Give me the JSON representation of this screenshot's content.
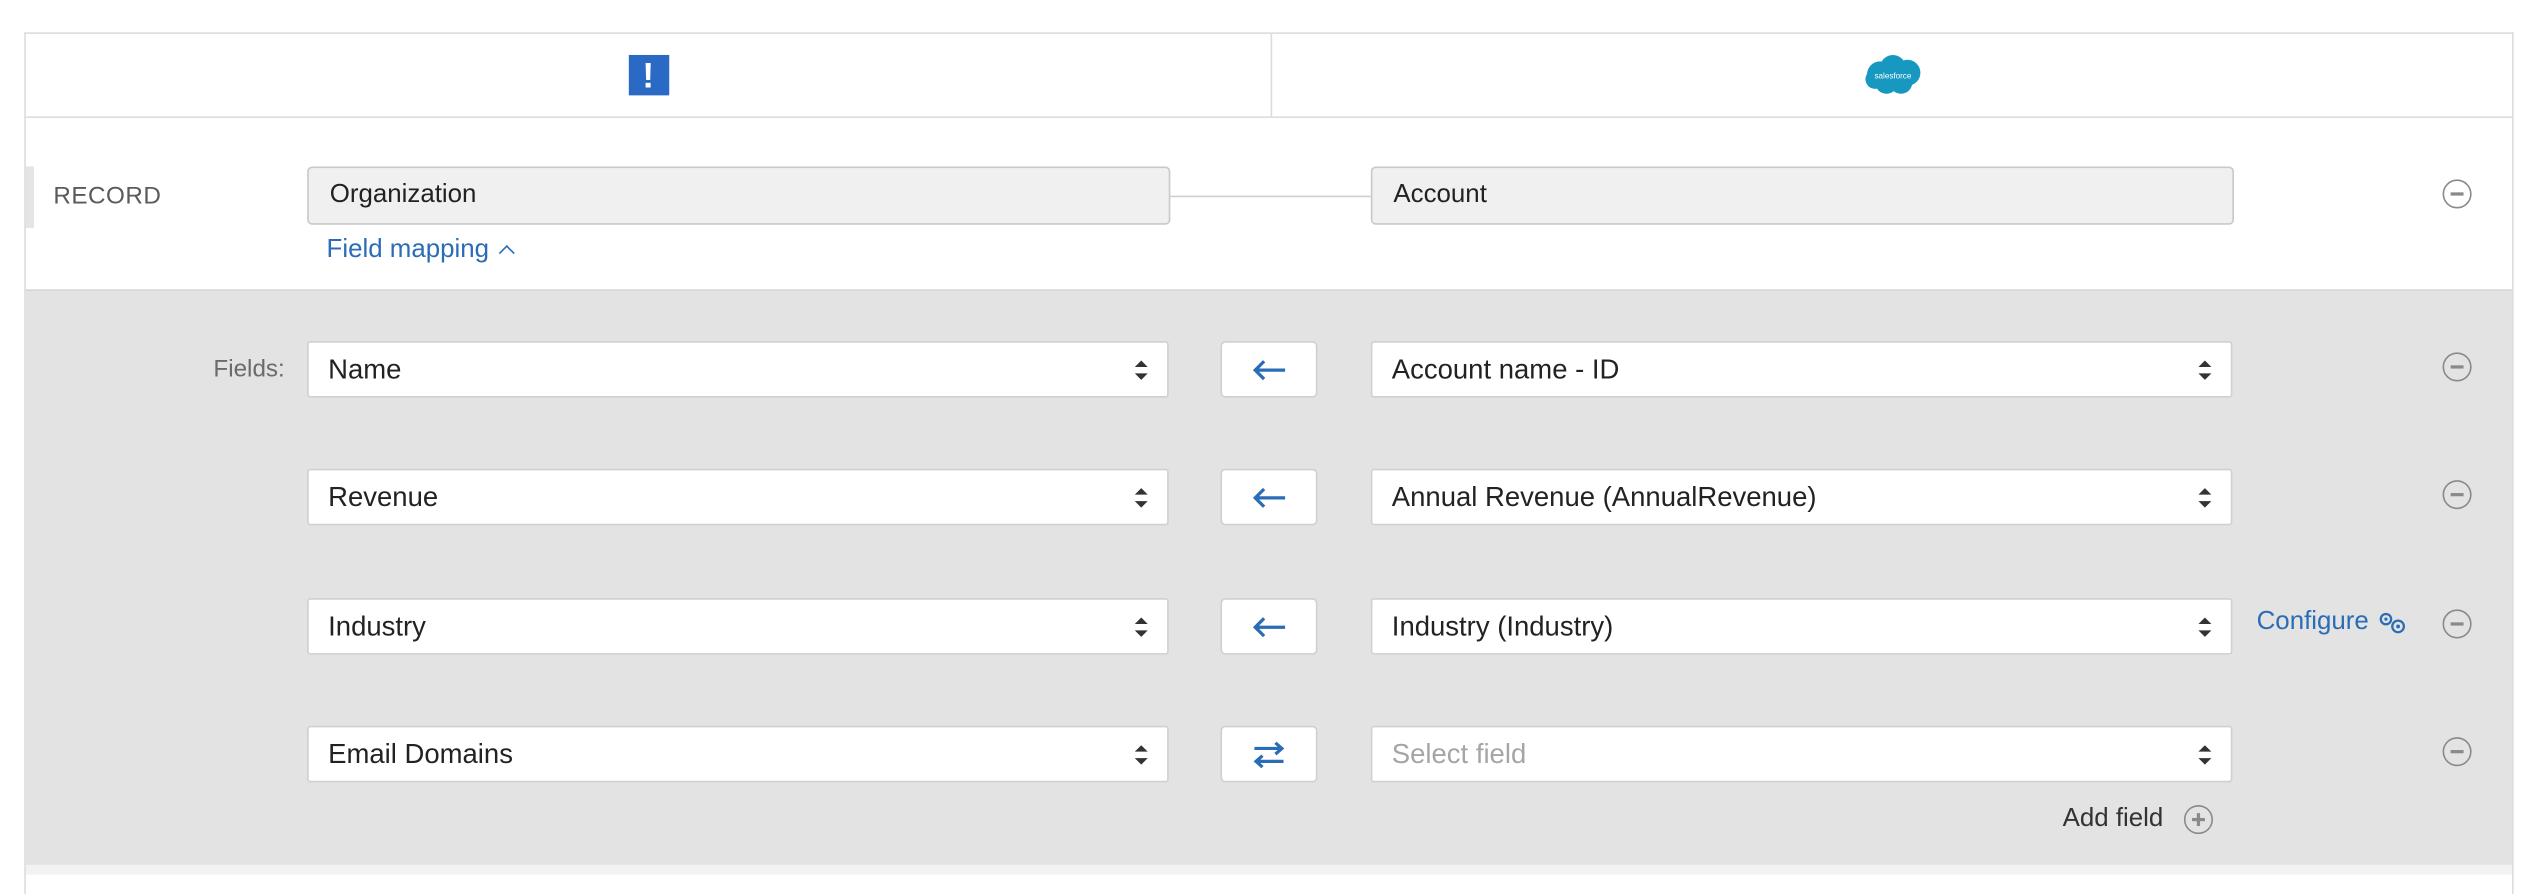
{
  "header": {
    "left_app_icon": "exclamation-app-icon",
    "right_app_icon": "salesforce-cloud-icon",
    "right_app_logo_text": "salesforce"
  },
  "record": {
    "label": "RECORD",
    "source_object": "Organization",
    "target_object": "Account",
    "field_mapping_link": "Field mapping"
  },
  "fields": {
    "label": "Fields:",
    "rows": [
      {
        "source": "Name",
        "direction": "arrow-left-icon",
        "target": "Account name - ID"
      },
      {
        "source": "Revenue",
        "direction": "arrow-left-icon",
        "target": "Annual Revenue (AnnualRevenue)"
      },
      {
        "source": "Industry",
        "direction": "arrow-left-icon",
        "target": "Industry (Industry)"
      },
      {
        "source": "Email Domains",
        "direction": "bidirectional-arrows-icon",
        "target": "Select field"
      }
    ],
    "configure_label": "Configure",
    "add_field_label": "Add field"
  },
  "colors": {
    "accent": "#2b6cb6",
    "app_icon_blue": "#2a6ac4",
    "salesforce_blue": "#1798c1",
    "mapping_background": "#e3e3e3"
  }
}
